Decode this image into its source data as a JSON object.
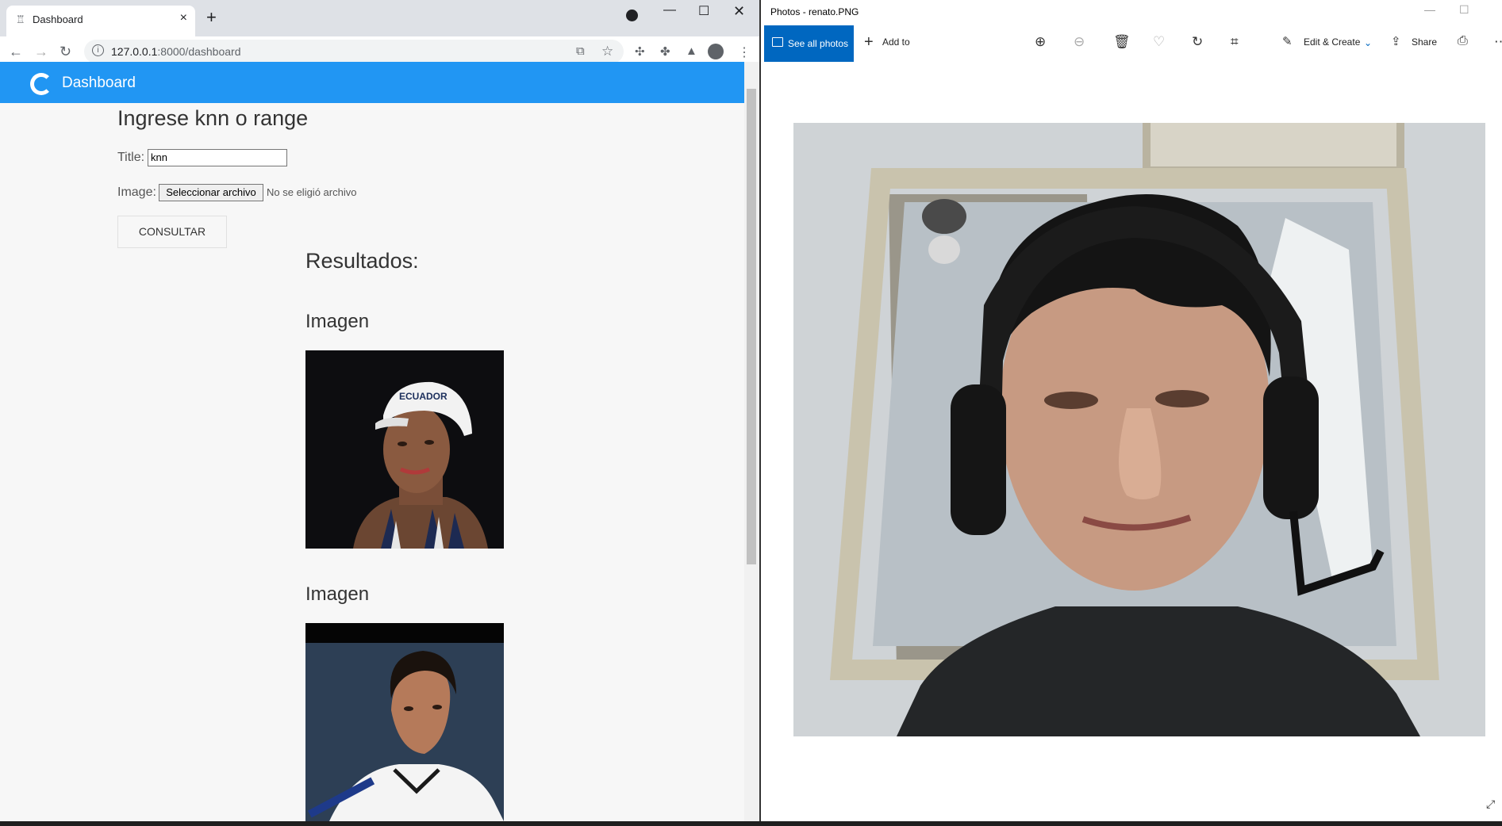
{
  "browser": {
    "tab_title": "Dashboard",
    "url_host": "127.0.0.1",
    "url_path": ":8000/dashboard"
  },
  "app": {
    "brand": "Dashboard",
    "heading": "Ingrese knn o range",
    "title_label": "Title:",
    "title_value": "knn",
    "image_label": "Image:",
    "file_button": "Seleccionar archivo",
    "file_status": "No se eligió archivo",
    "submit_label": "CONSULTAR",
    "results_heading": "Resultados:",
    "results": [
      {
        "label": "Imagen",
        "cap_text": "ECUADOR"
      },
      {
        "label": "Imagen"
      }
    ]
  },
  "photos": {
    "window_title": "Photos - renato.PNG",
    "see_all": "See all photos",
    "add_to": "Add to",
    "edit_create": "Edit & Create",
    "share": "Share"
  },
  "colors": {
    "appbar": "#2196f3",
    "photos_accent": "#0067c0"
  }
}
